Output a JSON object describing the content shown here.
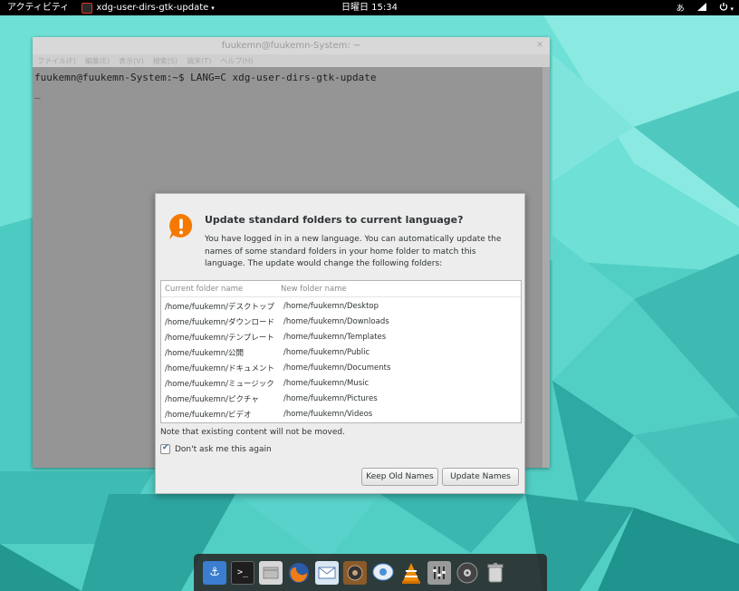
{
  "top_panel": {
    "activities_label": "アクティビティ",
    "app_title": "xdg-user-dirs-gtk-update",
    "app_caret": "▾",
    "clock": "日曜日 15:34",
    "input_method": "あ",
    "network_icon": "network-icon",
    "power_icon": "power-icon"
  },
  "terminal": {
    "title": "fuukemn@fuukemn-System: ~",
    "menu": [
      "ファイル(F)",
      "編集(E)",
      "表示(V)",
      "検索(S)",
      "端末(T)",
      "ヘルプ(H)"
    ],
    "command_line": "fuukemn@fuukemn-System:~$ LANG=C xdg-user-dirs-gtk-update",
    "cursor": "_"
  },
  "dialog": {
    "icon": "warning-icon",
    "title": "Update standard folders to current language?",
    "description": "You have logged in in a new language. You can automatically update the names of some standard folders in your home folder to match this language. The update would change the following folders:",
    "columns": {
      "current": "Current folder name",
      "new": "New folder name"
    },
    "rows": [
      {
        "current": "/home/fuukemn/デスクトップ",
        "new": "/home/fuukemn/Desktop"
      },
      {
        "current": "/home/fuukemn/ダウンロード",
        "new": "/home/fuukemn/Downloads"
      },
      {
        "current": "/home/fuukemn/テンプレート",
        "new": "/home/fuukemn/Templates"
      },
      {
        "current": "/home/fuukemn/公開",
        "new": "/home/fuukemn/Public"
      },
      {
        "current": "/home/fuukemn/ドキュメント",
        "new": "/home/fuukemn/Documents"
      },
      {
        "current": "/home/fuukemn/ミュージック",
        "new": "/home/fuukemn/Music"
      },
      {
        "current": "/home/fuukemn/ピクチャ",
        "new": "/home/fuukemn/Pictures"
      },
      {
        "current": "/home/fuukemn/ビデオ",
        "new": "/home/fuukemn/Videos"
      }
    ],
    "note": "Note that existing content will not be moved.",
    "checkbox_label": "Don't ask me this again",
    "checkbox_checked": true,
    "keep_button": "Keep Old Names",
    "update_button": "Update Names"
  },
  "dock": {
    "items": [
      {
        "name": "anchor-icon",
        "color": "#3b7ecf"
      },
      {
        "name": "terminal-icon",
        "color": "#2a2a2a"
      },
      {
        "name": "files-icon",
        "color": "#cfcfcf"
      },
      {
        "name": "firefox-icon",
        "color": "#e66000"
      },
      {
        "name": "mail-icon",
        "color": "#5b7fb3"
      },
      {
        "name": "audio-player-icon",
        "color": "#8a5a2b"
      },
      {
        "name": "chat-icon",
        "color": "#4a90d9"
      },
      {
        "name": "vlc-icon",
        "color": "#f08a00"
      },
      {
        "name": "mixer-icon",
        "color": "#8f8f8f"
      },
      {
        "name": "disc-icon",
        "color": "#555555"
      },
      {
        "name": "trash-icon",
        "color": "#bfbfbf"
      }
    ]
  }
}
